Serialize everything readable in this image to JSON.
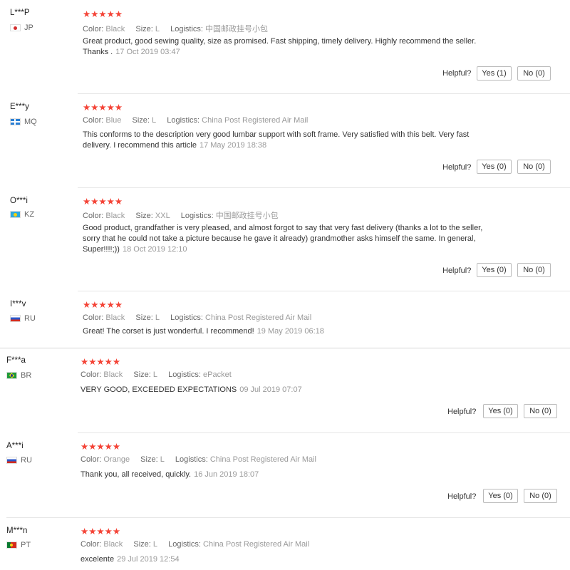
{
  "labels": {
    "color": "Color:",
    "size": "Size:",
    "logistics": "Logistics:",
    "helpful": "Helpful?"
  },
  "stars_glyph": "★★★★★",
  "reviews": [
    {
      "user": "L***P",
      "country": "JP",
      "flag": "jp-flag-icon",
      "color": "Black",
      "size": "L",
      "logistics": "中国邮政挂号小包",
      "text": "Great product, good sewing quality, size as promised. Fast shipping, timely delivery. Highly recommend the seller. Thanks .",
      "date": "17 Oct 2019 03:47",
      "yes": "Yes (1)",
      "no": "No (0)"
    },
    {
      "user": "E***y",
      "country": "MQ",
      "flag": "mq-flag-icon",
      "color": "Blue",
      "size": "L",
      "logistics": "China Post Registered Air Mail",
      "text": "This conforms to the description very good lumbar support with soft frame. Very satisfied with this belt. Very fast delivery. I recommend this article",
      "date": "17 May 2019 18:38",
      "yes": "Yes (0)",
      "no": "No (0)"
    },
    {
      "user": "O***i",
      "country": "KZ",
      "flag": "kz-flag-icon",
      "color": "Black",
      "size": "XXL",
      "logistics": "中国邮政挂号小包",
      "text": "Good product, grandfather is very pleased, and almost forgot to say that very fast delivery (thanks a lot to the seller, sorry that he could not take a picture because he gave it already) grandmother asks himself the same. In general, Super!!!!;))",
      "date": "18 Oct 2019 12:10",
      "yes": "Yes (0)",
      "no": "No (0)"
    },
    {
      "user": "I***v",
      "country": "RU",
      "flag": "ru-flag-icon",
      "color": "Black",
      "size": "L",
      "logistics": "China Post Registered Air Mail",
      "text": "Great! The corset is just wonderful. I recommend!",
      "date": "19 May 2019 06:18"
    },
    {
      "user": "F***a",
      "country": "BR",
      "flag": "br-flag-icon",
      "color": "Black",
      "size": "L",
      "logistics": "ePacket",
      "text": "VERY GOOD, EXCEEDED EXPECTATIONS",
      "date": "09 Jul 2019 07:07",
      "yes": "Yes (0)",
      "no": "No (0)"
    },
    {
      "user": "A***i",
      "country": "RU",
      "flag": "ru-flag-icon",
      "color": "Orange",
      "size": "L",
      "logistics": "China Post Registered Air Mail",
      "text": "Thank you, all received, quickly.",
      "date": "16 Jun 2019 18:07",
      "yes": "Yes (0)",
      "no": "No (0)"
    },
    {
      "user": "M***n",
      "country": "PT",
      "flag": "pt-flag-icon",
      "color": "Black",
      "size": "L",
      "logistics": "China Post Registered Air Mail",
      "text": "excelente",
      "date": "29 Jul 2019 12:54"
    }
  ]
}
